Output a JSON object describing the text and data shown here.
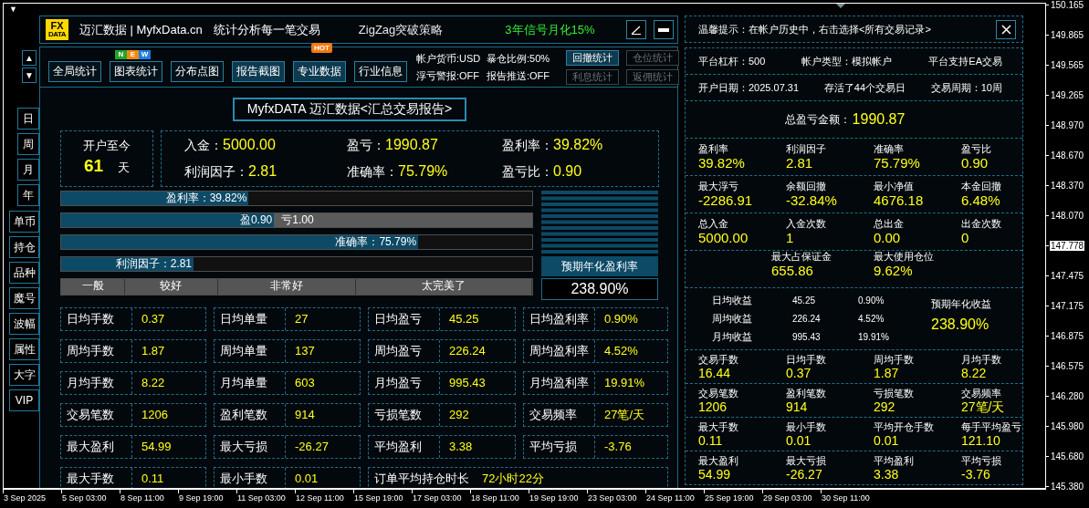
{
  "chart": {
    "collapse_arrow": "▼",
    "price_axis": [
      {
        "label": "150.165",
        "current": false
      },
      {
        "label": "149.865",
        "current": false
      },
      {
        "label": "149.565",
        "current": false
      },
      {
        "label": "149.265",
        "current": false
      },
      {
        "label": "148.970",
        "current": false
      },
      {
        "label": "148.670",
        "current": false
      },
      {
        "label": "148.370",
        "current": false
      },
      {
        "label": "148.070",
        "current": false
      },
      {
        "label": "147.778",
        "current": true
      },
      {
        "label": "147.475",
        "current": false
      },
      {
        "label": "147.175",
        "current": false
      },
      {
        "label": "146.875",
        "current": false
      },
      {
        "label": "146.575",
        "current": false
      },
      {
        "label": "146.280",
        "current": false
      },
      {
        "label": "145.980",
        "current": false
      },
      {
        "label": "145.680",
        "current": false
      },
      {
        "label": "145.380",
        "current": false
      }
    ],
    "time_axis": [
      "3 Sep 2025",
      "5 Sep 03:00",
      "8 Sep 11:00",
      "9 Sep 19:00",
      "11 Sep 03:00",
      "12 Sep 11:00",
      "15 Sep 19:00",
      "17 Sep 03:00",
      "18 Sep 11:00",
      "19 Sep 19:00",
      "23 Sep 03:00",
      "24 Sep 11:00",
      "25 Sep 19:00",
      "29 Sep 03:00",
      "30 Sep 11:00"
    ]
  },
  "side_nav": {
    "up": "▲",
    "down": "▼",
    "periods": [
      "日",
      "周",
      "月",
      "年"
    ],
    "tools": [
      "单币",
      "持仓",
      "品种",
      "魔号",
      "波幅",
      "属性",
      "大字",
      "VIP"
    ]
  },
  "main_panel": {
    "logo": {
      "line_1": "FX",
      "line_2": "DATA"
    },
    "title": "迈汇数据 | MyfxData.cn",
    "slogan": "统计分析每一笔交易",
    "strategy": "ZigZag突破策略",
    "signal": "3年信号月化15%",
    "tabs": [
      {
        "label": "全局统计",
        "highlighted": false
      },
      {
        "label": "图表统计",
        "highlighted": false,
        "badge_tiles": [
          "N",
          "E",
          "W"
        ]
      },
      {
        "label": "分布点图",
        "highlighted": false
      },
      {
        "label": "报告截图",
        "highlighted": true
      },
      {
        "label": "专业数据",
        "highlighted": true,
        "badge": "HOT"
      },
      {
        "label": "行业信息",
        "highlighted": false
      }
    ],
    "account_info": [
      "帐户货币:USD",
      "暴仓比例:50%",
      "浮亏警报:OFF",
      "报告推送:OFF"
    ],
    "side_buttons": [
      {
        "label": "回撤统计",
        "disabled": false
      },
      {
        "label": "仓位统计",
        "disabled": true
      },
      {
        "label": "利息统计",
        "disabled": true
      },
      {
        "label": "返佣统计",
        "disabled": true
      }
    ],
    "report_title": "MyfxDATA 迈汇数据<汇总交易报告>",
    "since_open": {
      "label": "开户至今",
      "value": "61",
      "unit": "天"
    },
    "summary": [
      {
        "label": "入金：",
        "value": "5000.00"
      },
      {
        "label": "盈亏：",
        "value": "1990.87"
      },
      {
        "label": "盈利率：",
        "value": "39.82%"
      },
      {
        "label": "利润因子：",
        "value": "2.81"
      },
      {
        "label": "准确率：",
        "value": "75.79%"
      },
      {
        "label": "盈亏比：",
        "value": "0.90"
      }
    ],
    "bars": [
      {
        "kind": "single",
        "text": "盈利率：39.82%",
        "level": 0.398
      },
      {
        "kind": "split",
        "win": "盈0.90",
        "loss": "亏1.00",
        "level": 0.452
      },
      {
        "kind": "single",
        "text": "准确率：75.79%",
        "level": 0.758
      },
      {
        "kind": "single",
        "text": "利润因子：2.81",
        "level": 0.281
      }
    ],
    "rating_scale": [
      "一般",
      "较好",
      "非常好",
      "太完美了"
    ],
    "annual": {
      "label": "预期年化盈利率",
      "value": "238.90%"
    },
    "stats": [
      [
        {
          "label": "日均手数",
          "value": "0.37"
        },
        {
          "label": "日均单量",
          "value": "27"
        },
        {
          "label": "日均盈亏",
          "value": "45.25"
        },
        {
          "label": "日均盈利率",
          "value": "0.90%"
        }
      ],
      [
        {
          "label": "周均手数",
          "value": "1.87"
        },
        {
          "label": "周均单量",
          "value": "137"
        },
        {
          "label": "周均盈亏",
          "value": "226.24"
        },
        {
          "label": "周均盈利率",
          "value": "4.52%"
        }
      ],
      [
        {
          "label": "月均手数",
          "value": "8.22"
        },
        {
          "label": "月均单量",
          "value": "603"
        },
        {
          "label": "月均盈亏",
          "value": "995.43"
        },
        {
          "label": "月均盈利率",
          "value": "19.91%"
        }
      ],
      [
        {
          "label": "交易笔数",
          "value": "1206"
        },
        {
          "label": "盈利笔数",
          "value": "914"
        },
        {
          "label": "亏损笔数",
          "value": "292"
        },
        {
          "label": "交易频率",
          "value": "27笔/天"
        }
      ],
      [
        {
          "label": "最大盈利",
          "value": "54.99"
        },
        {
          "label": "最大亏损",
          "value": "-26.27"
        },
        {
          "label": "平均盈利",
          "value": "3.38"
        },
        {
          "label": "平均亏损",
          "value": "-3.76"
        }
      ],
      [
        {
          "label": "最大手数",
          "value": "0.11"
        },
        {
          "label": "最小手数",
          "value": "0.01"
        },
        {
          "label": "订单平均持仓时长",
          "value": "72小时22分",
          "wide": true
        }
      ]
    ]
  },
  "right_panel": {
    "tip": "温馨提示：在帐户历史中，右击选择<所有交易记录>",
    "info_rows": [
      [
        "平台杠杆：500",
        "帐户类型：模拟帐户",
        "平台支持EA交易"
      ],
      [
        "开户日期：2025.07.31",
        "存活了44个交易日",
        "交易周期：10周"
      ]
    ],
    "total": {
      "label": "总盈亏金额：",
      "value": "1990.87"
    },
    "upper_rows": [
      {
        "kind": "grid",
        "items": [
          {
            "label": "盈利率",
            "value": "39.82%"
          },
          {
            "label": "利润因子",
            "value": "2.81"
          },
          {
            "label": "准确率",
            "value": "75.79%"
          },
          {
            "label": "盈亏比",
            "value": "0.90"
          }
        ]
      },
      {
        "kind": "grid",
        "items": [
          {
            "label": "最大浮亏",
            "value": "-2286.91"
          },
          {
            "label": "余额回撤",
            "value": "-32.84%"
          },
          {
            "label": "最小净值",
            "value": "4676.18"
          },
          {
            "label": "本金回撤",
            "value": "6.48%"
          }
        ]
      },
      {
        "kind": "grid",
        "items": [
          {
            "label": "总入金",
            "value": "5000.00"
          },
          {
            "label": "入金次数",
            "value": "1"
          },
          {
            "label": "总出金",
            "value": "0.00"
          },
          {
            "label": "出金次数",
            "value": "0"
          }
        ]
      },
      {
        "kind": "centered",
        "items": [
          {
            "label": "最大占保证金",
            "value": "655.86"
          },
          {
            "label": "最大使用仓位",
            "value": "9.62%"
          }
        ]
      }
    ],
    "averages": [
      {
        "label": "日均收益",
        "amount": "45.25",
        "percent": "0.90%"
      },
      {
        "label": "周均收益",
        "amount": "226.24",
        "percent": "4.52%"
      },
      {
        "label": "月均收益",
        "amount": "995.43",
        "percent": "19.91%"
      }
    ],
    "annual": {
      "label": "预期年化收益",
      "value": "238.90%"
    },
    "lower_rows": [
      [
        {
          "label": "交易手数",
          "value": "16.44"
        },
        {
          "label": "日均手数",
          "value": "0.37"
        },
        {
          "label": "周均手数",
          "value": "1.87"
        },
        {
          "label": "月均手数",
          "value": "8.22"
        }
      ],
      [
        {
          "label": "交易笔数",
          "value": "1206"
        },
        {
          "label": "盈利笔数",
          "value": "914"
        },
        {
          "label": "亏损笔数",
          "value": "292"
        },
        {
          "label": "交易频率",
          "value": "27笔/天"
        }
      ],
      [
        {
          "label": "最大手数",
          "value": "0.11"
        },
        {
          "label": "最小手数",
          "value": "0.01"
        },
        {
          "label": "平均开仓手数",
          "value": "0.01"
        },
        {
          "label": "每手平均盈亏",
          "value": "121.10"
        }
      ],
      [
        {
          "label": "最大盈利",
          "value": "54.99"
        },
        {
          "label": "最大亏损",
          "value": "-26.27"
        },
        {
          "label": "平均盈利",
          "value": "3.38"
        },
        {
          "label": "平均亏损",
          "value": "-3.76"
        }
      ]
    ]
  }
}
